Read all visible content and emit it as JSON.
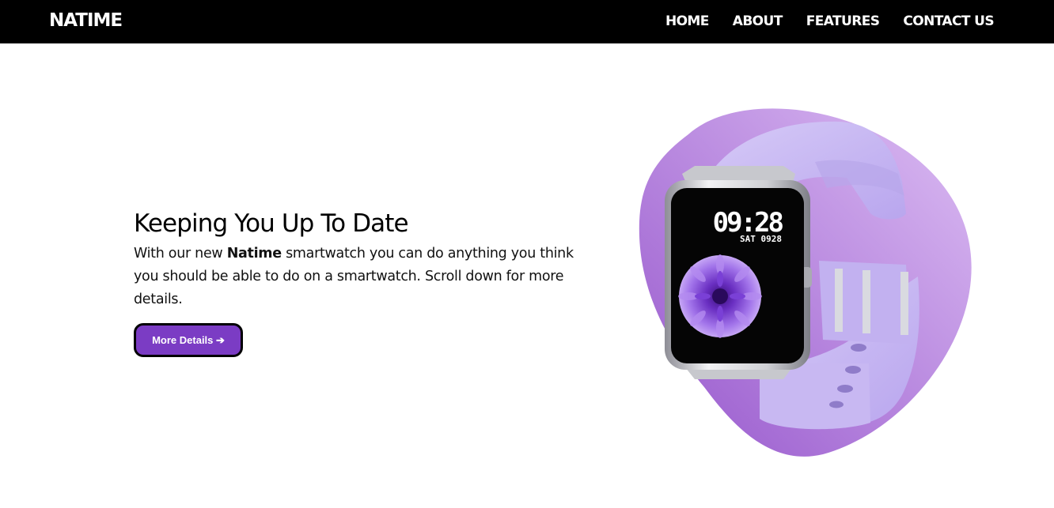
{
  "nav": {
    "logo": "NATIME",
    "links": [
      "HOME",
      "ABOUT",
      "FEATURES",
      "CONTACT US"
    ]
  },
  "hero": {
    "title": "Keeping You Up To Date",
    "desc_before": "With our new ",
    "desc_brand": "Natime",
    "desc_after": " smartwatch you can do anything you think you should be able to do on a smartwatch. Scroll down for more details.",
    "button_label": "More Details ➔"
  },
  "watch": {
    "time": "09:28",
    "date": "SAT 0928"
  },
  "colors": {
    "nav_bg": "#000000",
    "accent": "#7b3cc4",
    "blob_light": "#d8b4f0",
    "blob_dark": "#9b5fd0",
    "strap": "#c9b8f2"
  }
}
